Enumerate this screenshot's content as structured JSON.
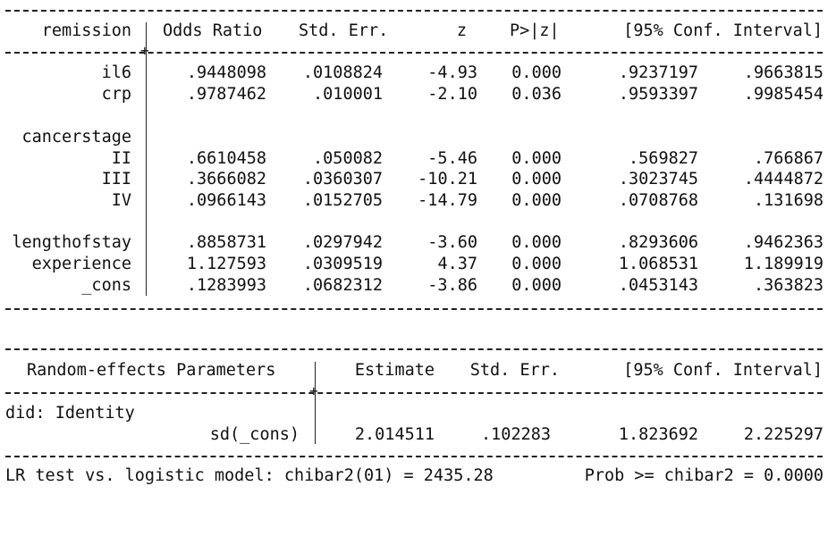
{
  "main_table": {
    "headers": [
      "remission",
      "Odds Ratio",
      "Std. Err.",
      "z",
      "P>|z|",
      "[95% Conf. Interval]"
    ],
    "rows": [
      {
        "label": "il6",
        "values": [
          ".9448098",
          ".0108824",
          "-4.93",
          "0.000",
          ".9237197",
          ".9663815"
        ]
      },
      {
        "label": "crp",
        "values": [
          ".9787462",
          ".010001",
          "-2.10",
          "0.036",
          ".9593397",
          ".9985454"
        ]
      },
      {
        "label": "cancerstage",
        "values": []
      },
      {
        "label": "II",
        "values": [
          ".6610458",
          ".050082",
          "-5.46",
          "0.000",
          ".569827",
          ".766867"
        ]
      },
      {
        "label": "III",
        "values": [
          ".3666082",
          ".0360307",
          "-10.21",
          "0.000",
          ".3023745",
          ".4444872"
        ]
      },
      {
        "label": "IV",
        "values": [
          ".0966143",
          ".0152705",
          "-14.79",
          "0.000",
          ".0708768",
          ".131698"
        ]
      },
      {
        "label": "lengthofstay",
        "values": [
          ".8858731",
          ".0297942",
          "-3.60",
          "0.000",
          ".8293606",
          ".9462363"
        ]
      },
      {
        "label": "experience",
        "values": [
          "1.127593",
          ".0309519",
          "4.37",
          "0.000",
          "1.068531",
          "1.189919"
        ]
      },
      {
        "label": "_cons",
        "values": [
          ".1283993",
          ".0682312",
          "-3.86",
          "0.000",
          ".0453143",
          ".363823"
        ]
      }
    ]
  },
  "re_table": {
    "headers": [
      "Random-effects Parameters",
      "Estimate",
      "Std. Err.",
      "[95% Conf. Interval]"
    ],
    "group_label": "did: Identity",
    "row": {
      "label": "sd(_cons)",
      "values": [
        "2.014511",
        ".102283",
        "1.823692",
        "2.225297"
      ]
    }
  },
  "lr_test": {
    "text": "LR test vs. logistic model: chibar2(01) = 2435.28",
    "prob": "Prob >= chibar2 = 0.0000"
  }
}
